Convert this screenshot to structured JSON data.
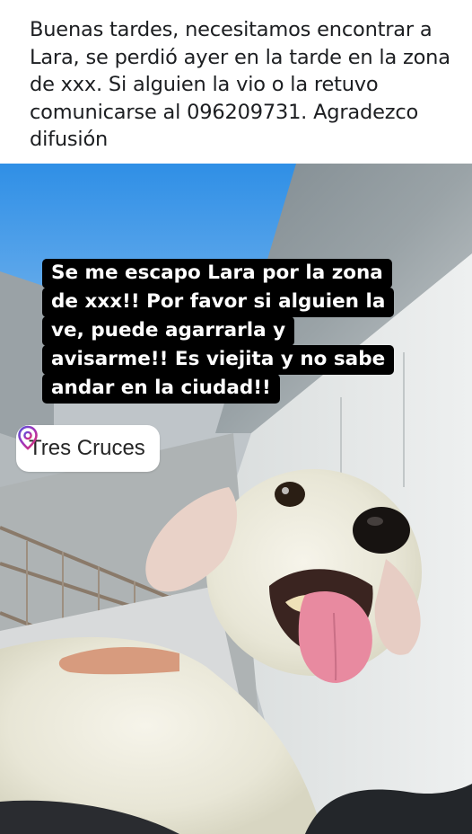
{
  "post": {
    "text": "Buenas tardes, necesitamos encontrar a Lara, se perdió ayer en la tarde en la zona de xxx. Si alguien la vio o la retuvo comunicarse al 096209731. Agradezco difusión"
  },
  "story": {
    "caption_lines": [
      "Se me escapo Lara por la zona",
      "de xxx!! Por favor si alguien la",
      "ve, puede agarrarla y",
      "avisarme!! Es viejita y no sabe",
      "andar en la ciudad!!"
    ],
    "location_label": "Tres Cruces",
    "location_icon": "location-pin-icon",
    "location_icon_color": "#8a3ab9"
  },
  "colors": {
    "caption_bg": "#000000",
    "caption_text": "#ffffff",
    "post_text": "#1c1e21"
  }
}
